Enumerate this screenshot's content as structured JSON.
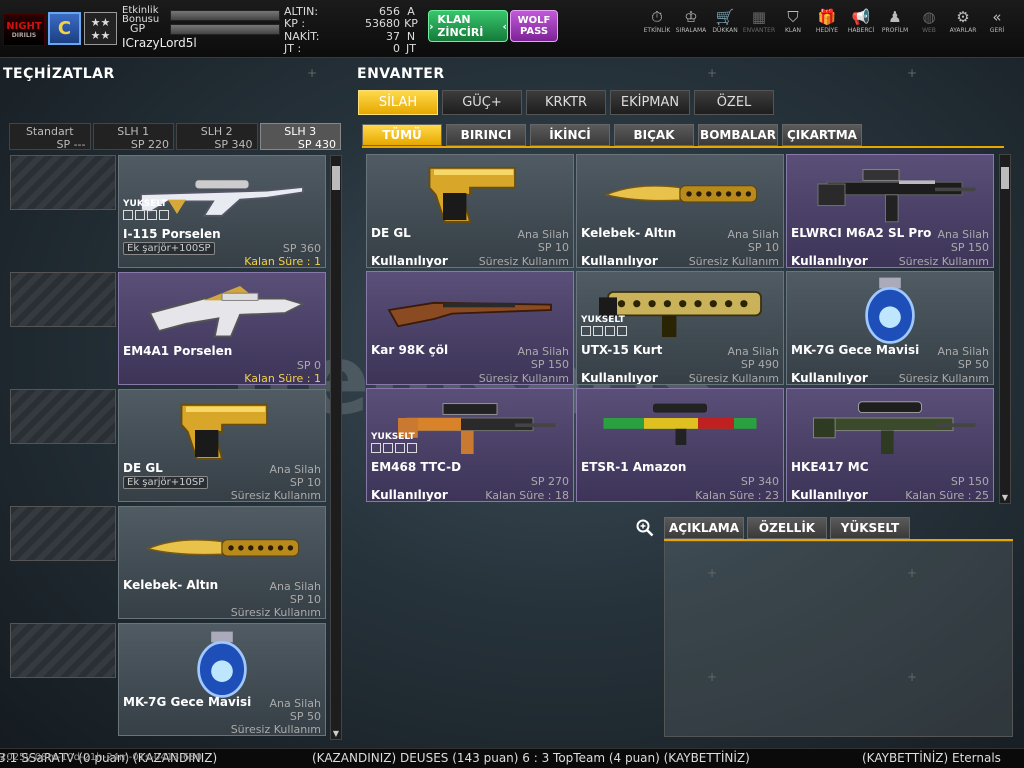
{
  "player": {
    "bonus_label": "Etkinlik\nBonusu",
    "gp_label": "GP",
    "username": "ICrazyLord5l",
    "rank_stars": "★★\n★★"
  },
  "logo": {
    "text": "NIGHT",
    "sub": "DIRILIS"
  },
  "currency": [
    {
      "label": "ALTIN:",
      "value": "656",
      "unit": "A"
    },
    {
      "label": "KP :",
      "value": "53680",
      "unit": "KP"
    },
    {
      "label": "NAKİT:",
      "value": "37",
      "unit": "N"
    },
    {
      "label": "JT :",
      "value": "0",
      "unit": "JT"
    }
  ],
  "buttons": {
    "klan": "KLAN ZİNCİRİ",
    "wolf": "WOLF PASS"
  },
  "nav": [
    {
      "label": "ETKİNLİK",
      "icon": "⏱",
      "name": "event-icon"
    },
    {
      "label": "SIRALAMA",
      "icon": "♔",
      "name": "ranking-icon"
    },
    {
      "label": "DÜKKAN",
      "icon": "🛒",
      "name": "shop-icon"
    },
    {
      "label": "ENVANTER",
      "icon": "▦",
      "name": "inventory-icon",
      "dim": true
    },
    {
      "label": "KLAN",
      "icon": "⛉",
      "name": "clan-icon"
    },
    {
      "label": "HEDİYE",
      "icon": "🎁",
      "name": "gift-icon"
    },
    {
      "label": "HABERCİ",
      "icon": "📢",
      "name": "messenger-icon"
    },
    {
      "label": "PROFİLM",
      "icon": "♟",
      "name": "profile-icon"
    },
    {
      "label": "WEB",
      "icon": "◍",
      "name": "web-icon",
      "dim": true
    },
    {
      "label": "AYARLAR",
      "icon": "⚙",
      "name": "settings-icon"
    },
    {
      "label": "GERİ",
      "icon": "«",
      "name": "back-icon"
    }
  ],
  "headings": {
    "left": "TEÇHİZATLAR",
    "right": "ENVANTER"
  },
  "slot_tabs": [
    {
      "title": "Standart",
      "sp": "SP ---"
    },
    {
      "title": "SLH 1",
      "sp": "SP 220"
    },
    {
      "title": "SLH 2",
      "sp": "SP 340"
    },
    {
      "title": "SLH 3",
      "sp": "SP 430",
      "active": true
    }
  ],
  "equipment": [
    {
      "name": "I-115 Porselen",
      "category": "",
      "sp": "SP 360",
      "status": "Kalan Süre : 1",
      "status_color": "yellow",
      "ammo": "Ek şarjör+100SP",
      "upgrade": "YUKSELT",
      "gun": "sniper-white",
      "purple": false
    },
    {
      "name": "EM4A1 Porselen",
      "category": "",
      "sp": "SP 0",
      "status": "Kalan Süre : 1",
      "status_color": "yellow",
      "ammo": "",
      "upgrade": "",
      "gun": "rifle-white",
      "purple": true
    },
    {
      "name": "DE GL",
      "category": "Ana Silah",
      "sp": "SP 10",
      "status": "Süresiz Kullanım",
      "status_color": "gray",
      "ammo": "Ek şarjör+10SP",
      "upgrade": "",
      "gun": "pistol-gold",
      "purple": false
    },
    {
      "name": "Kelebek- Altın",
      "category": "Ana Silah",
      "sp": "SP 10",
      "status": "Süresiz Kullanım",
      "status_color": "gray",
      "ammo": "",
      "upgrade": "",
      "gun": "knife-gold",
      "purple": false
    },
    {
      "name": "MK-7G Gece Mavisi",
      "category": "Ana Silah",
      "sp": "SP 50",
      "status": "Süresiz Kullanım",
      "status_color": "gray",
      "ammo": "",
      "upgrade": "",
      "gun": "grenade-blue",
      "purple": false
    }
  ],
  "cat_tabs": [
    {
      "label": "SİLAH",
      "active": true
    },
    {
      "label": "GÜÇ+"
    },
    {
      "label": "KRKTR"
    },
    {
      "label": "EKİPMAN"
    },
    {
      "label": "ÖZEL"
    }
  ],
  "sub_tabs": [
    {
      "label": "TÜMÜ",
      "active": true
    },
    {
      "label": "BIRINCI"
    },
    {
      "label": "İKİNCİ"
    },
    {
      "label": "BIÇAK"
    },
    {
      "label": "BOMBALAR"
    },
    {
      "label": "ÇIKARTMA"
    }
  ],
  "inventory": [
    {
      "name": "DE GL",
      "category": "Ana Silah",
      "sp": "SP 10",
      "use": "Kullanılıyor",
      "status": "Süresiz Kullanım",
      "upgrade": "",
      "gun": "pistol-gold",
      "purple": false
    },
    {
      "name": "Kelebek- Altın",
      "category": "Ana Silah",
      "sp": "SP 10",
      "use": "Kullanılıyor",
      "status": "Süresiz Kullanım",
      "upgrade": "",
      "gun": "knife-gold",
      "purple": false
    },
    {
      "name": "ELWRCI M6A2 SL Pro",
      "category": "Ana Silah",
      "sp": "SP 150",
      "use": "Kullanılıyor",
      "status": "Süresiz Kullanım",
      "upgrade": "",
      "gun": "rifle-black",
      "purple": true
    },
    {
      "name": "Kar 98K çöl",
      "category": "Ana Silah",
      "sp": "SP 150",
      "use": "",
      "status": "Süresiz Kullanım",
      "upgrade": "",
      "gun": "rifle-wood",
      "purple": true
    },
    {
      "name": "UTX-15 Kurt",
      "category": "Ana Silah",
      "sp": "SP 490",
      "use": "Kullanılıyor",
      "status": "Süresiz Kullanım",
      "upgrade": "YUKSELT",
      "gun": "shotgun-gold",
      "purple": false
    },
    {
      "name": "MK-7G Gece Mavisi",
      "category": "Ana Silah",
      "sp": "SP 50",
      "use": "Kullanılıyor",
      "status": "Süresiz Kullanım",
      "upgrade": "",
      "gun": "grenade-blue",
      "purple": false
    },
    {
      "name": "EM468 TTC-D",
      "category": "",
      "sp": "SP 270",
      "use": "Kullanılıyor",
      "status": "Kalan Süre : 18",
      "upgrade": "YUKSELT",
      "gun": "rifle-orange",
      "purple": true
    },
    {
      "name": "ETSR-1 Amazon",
      "category": "",
      "sp": "SP 340",
      "use": "",
      "status": "Kalan Süre : 23",
      "upgrade": "",
      "gun": "sniper-green",
      "purple": true
    },
    {
      "name": "HKE417 MC",
      "category": "",
      "sp": "SP 150",
      "use": "Kullanılıyor",
      "status": "Kalan Süre : 25",
      "upgrade": "",
      "gun": "rifle-camo",
      "purple": true
    }
  ],
  "detail_tabs": [
    "AÇIKLAMA",
    "ÖZELLİK",
    "YÜKSELT"
  ],
  "ticker": {
    "a": "3:1 SSaRATV (0 puan) (KAZANDINIZ)",
    "b": "(KAZANDINIZ) DEUSES (143 puan) 6 : 3 TopTeam (4 puan) (KAYBETTİNİZ)",
    "c": "(KAYBETTİNİZ) Eternals"
  },
  "stamp": "2025y-08m-10d-21h-24m-01s-0413-680",
  "watermark": "itemsatis",
  "colors": {
    "accent": "#e6a800",
    "purple": "#5a4f78",
    "klan": "#2aa85a",
    "wolf": "#a040c0"
  }
}
